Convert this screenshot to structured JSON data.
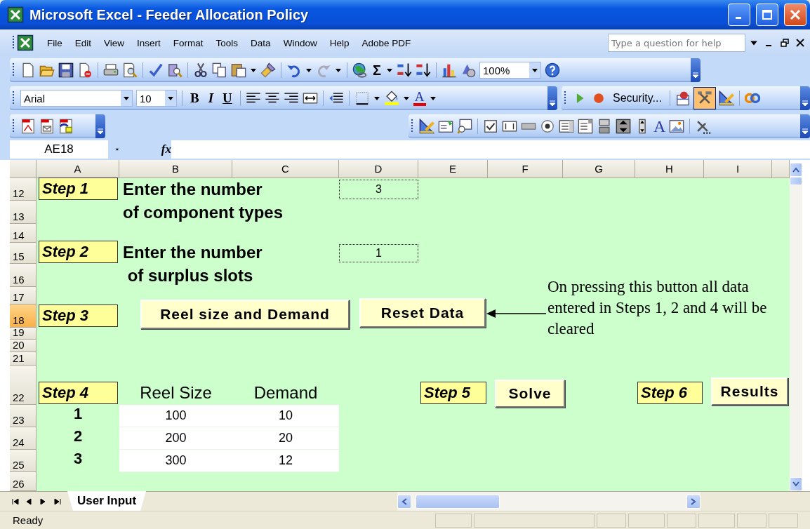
{
  "window": {
    "title": "Microsoft Excel - Feeder Allocation Policy"
  },
  "menu": [
    {
      "label": "File"
    },
    {
      "label": "Edit"
    },
    {
      "label": "View"
    },
    {
      "label": "Insert"
    },
    {
      "label": "Format"
    },
    {
      "label": "Tools"
    },
    {
      "label": "Data"
    },
    {
      "label": "Window"
    },
    {
      "label": "Help"
    },
    {
      "label": "Adobe PDF"
    }
  ],
  "help_box": {
    "placeholder": "Type a question for help"
  },
  "standard_toolbar": {
    "sum": "Σ",
    "zoom": "100%"
  },
  "formatting_toolbar": {
    "font": "Arial",
    "size": "10",
    "bold": "B",
    "italic": "I",
    "underline": "U",
    "font_color": "A"
  },
  "visual_basic_toolbar": {
    "security": "Security...",
    "design_mode": {
      "selected": true
    }
  },
  "control_toolbox": {
    "label_tool": "A"
  },
  "formula_bar": {
    "name_box": "AE18",
    "function_label": "fx"
  },
  "sheet": {
    "columns": [
      "A",
      "B",
      "C",
      "D",
      "E",
      "F",
      "G",
      "H",
      "I"
    ],
    "rows": [
      {
        "number": "12",
        "selected": false,
        "cells": {
          "A": {
            "kind": "step",
            "text": "Step 1"
          },
          "B": {
            "kind": "label",
            "text": "Enter the number"
          },
          "D": {
            "kind": "input",
            "text": "3"
          }
        }
      },
      {
        "number": "13",
        "selected": false,
        "cells": {
          "B": {
            "kind": "label",
            "text": "of component types"
          }
        }
      },
      {
        "number": "14",
        "selected": false,
        "cells": {}
      },
      {
        "number": "15",
        "selected": false,
        "cells": {
          "A": {
            "kind": "step",
            "text": "Step 2"
          },
          "B": {
            "kind": "label",
            "text": "Enter the number"
          },
          "D": {
            "kind": "input",
            "text": "1"
          }
        }
      },
      {
        "number": "16",
        "selected": false,
        "cells": {
          "B": {
            "kind": "label",
            "text": " of surplus slots"
          }
        }
      },
      {
        "number": "17",
        "selected": false,
        "cells": {}
      },
      {
        "number": "18",
        "selected": true,
        "cells": {
          "A": {
            "kind": "step",
            "text": "Step 3"
          }
        }
      },
      {
        "number": "19",
        "selected": false,
        "cells": {}
      },
      {
        "number": "20",
        "selected": false,
        "cells": {}
      },
      {
        "number": "21",
        "selected": false,
        "cells": {}
      },
      {
        "number": "22",
        "selected": false,
        "cells": {
          "A": {
            "kind": "step",
            "text": "Step 4"
          },
          "B": {
            "kind": "header",
            "text": "Reel Size"
          },
          "C": {
            "kind": "header",
            "text": "Demand"
          },
          "E": {
            "kind": "step",
            "text": "Step 5"
          },
          "H": {
            "kind": "step",
            "text": "Step 6"
          }
        }
      },
      {
        "number": "23",
        "selected": false,
        "cells": {
          "A": {
            "kind": "index",
            "text": "1"
          },
          "B": {
            "kind": "value",
            "text": "100"
          },
          "C": {
            "kind": "value",
            "text": "10"
          }
        }
      },
      {
        "number": "24",
        "selected": false,
        "cells": {
          "A": {
            "kind": "index",
            "text": "2"
          },
          "B": {
            "kind": "value",
            "text": "200"
          },
          "C": {
            "kind": "value",
            "text": "20"
          }
        }
      },
      {
        "number": "25",
        "selected": false,
        "cells": {
          "A": {
            "kind": "index",
            "text": "3"
          },
          "B": {
            "kind": "value",
            "text": "300"
          },
          "C": {
            "kind": "value",
            "text": "12"
          }
        }
      },
      {
        "number": "26",
        "selected": false,
        "cells": {}
      }
    ]
  },
  "buttons": [
    {
      "label": "Reel size and Demand"
    },
    {
      "label": "Reset Data"
    },
    {
      "label": "Solve"
    },
    {
      "label": "Results"
    }
  ],
  "annotation": "On pressing this button all data entered in Steps 1, 2 and 4 will be cleared",
  "sheet_tabs": [
    {
      "label": "User Input",
      "selected": true
    }
  ],
  "status_bar": {
    "text": "Ready"
  }
}
